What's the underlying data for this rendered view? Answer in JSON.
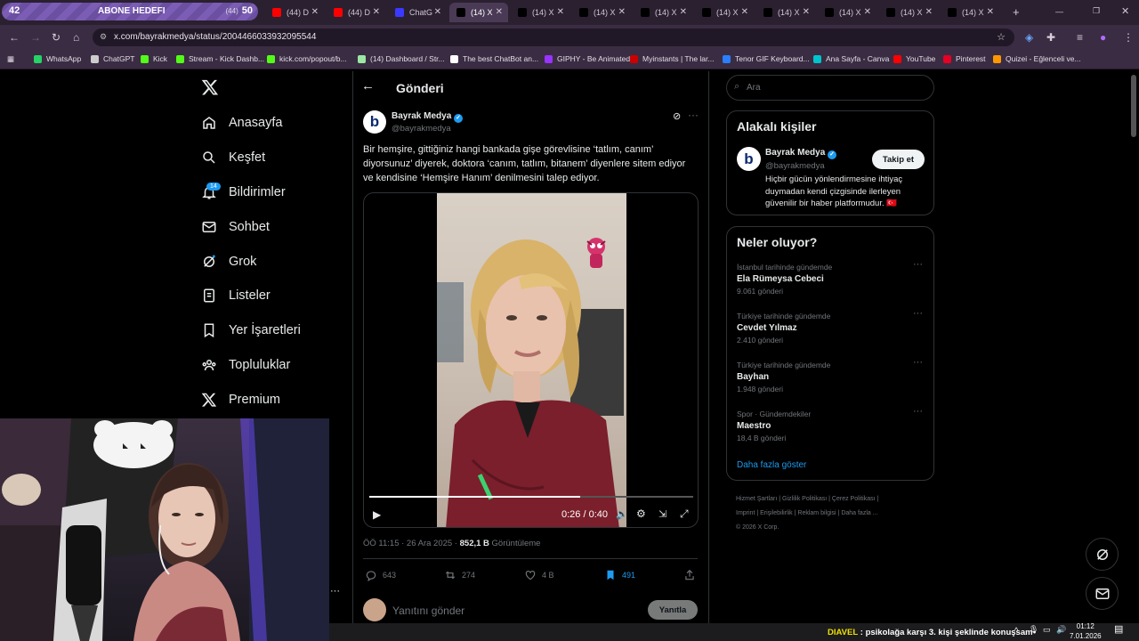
{
  "overlay": {
    "goal_count": "42",
    "goal_label": "ABONE HEDEFI",
    "goal_small": "(44)",
    "goal_target": "50"
  },
  "tabs": [
    {
      "label": "(44) D",
      "color": "#ff0000"
    },
    {
      "label": "(44) D",
      "color": "#ff0000"
    },
    {
      "label": "ChatG",
      "color": "#3a3aff"
    },
    {
      "label": "(14) X",
      "color": "#000000"
    },
    {
      "label": "(14) X",
      "color": "#000000"
    },
    {
      "label": "(14) X",
      "color": "#000000"
    },
    {
      "label": "(14) X",
      "color": "#000000"
    },
    {
      "label": "(14) X",
      "color": "#000000"
    },
    {
      "label": "(14) X",
      "color": "#000000"
    },
    {
      "label": "(14) X",
      "color": "#000000"
    },
    {
      "label": "(14) X",
      "color": "#000000"
    },
    {
      "label": "(14) X",
      "color": "#000000"
    }
  ],
  "browser": {
    "url": "x.com/bayrakmedya/status/2004466033932095544"
  },
  "bookmarks": [
    {
      "label": "WhatsApp",
      "color": "#25d366"
    },
    {
      "label": "ChatGPT",
      "color": "#cccccc"
    },
    {
      "label": "Kick",
      "color": "#53fc18"
    },
    {
      "label": "Stream - Kick Dashb...",
      "color": "#53fc18"
    },
    {
      "label": "kick.com/popout/b...",
      "color": "#53fc18"
    },
    {
      "label": "(14) Dashboard / Str...",
      "color": "#9be7a3"
    },
    {
      "label": "The best ChatBot an...",
      "color": "#ffffff"
    },
    {
      "label": "GIPHY - Be Animated",
      "color": "#9933ff"
    },
    {
      "label": "Myinstants | The lar...",
      "color": "#cc0000"
    },
    {
      "label": "Tenor GIF Keyboard...",
      "color": "#2a7fff"
    },
    {
      "label": "Ana Sayfa - Canva",
      "color": "#00c4cc"
    },
    {
      "label": "YouTube",
      "color": "#ff0000"
    },
    {
      "label": "Pinterest",
      "color": "#e60023"
    },
    {
      "label": "Quizei - Eğlenceli ve...",
      "color": "#ff9800"
    }
  ],
  "nav": {
    "items": [
      {
        "label": "Anasayfa"
      },
      {
        "label": "Keşfet"
      },
      {
        "label": "Bildirimler"
      },
      {
        "label": "Sohbet"
      },
      {
        "label": "Grok"
      },
      {
        "label": "Listeler"
      },
      {
        "label": "Yer İşaretleri"
      },
      {
        "label": "Topluluklar"
      },
      {
        "label": "Premium"
      }
    ],
    "notif_badge": "14"
  },
  "post": {
    "header_title": "Gönderi",
    "author_name": "Bayrak Medya",
    "author_handle": "@bayrakmedya",
    "text": "Bir hemşire, gittiğiniz hangi bankada gişe görevlisine ‘tatlım, canım’ diyorsunuz’ diyerek, doktora ‘canım, tatlım, bitanem’ diyenlere sitem ediyor ve kendisine ‘Hemşire Hanım’ denilmesini talep ediyor.",
    "video_time": "0:26 / 0:40",
    "video_progress": 0.65,
    "meta_time": "ÖÖ 11:15 · 26 Ara 2025 · ",
    "views": "852,1 B",
    "views_label": " Görüntüleme",
    "replies": "643",
    "reposts": "274",
    "likes": "4 B",
    "bookmarks": "491",
    "reply_placeholder": "Yanıtını gönder",
    "reply_button": "Yanıtla"
  },
  "sidebar": {
    "search_placeholder": "Ara",
    "people_title": "Alakalı kişiler",
    "person_name": "Bayrak Medya",
    "person_handle": "@bayrakmedya",
    "follow_label": "Takip et",
    "person_bio": "Hiçbir gücün yönlendirmesine ihtiyaç duymadan kendi çizgisinde ilerleyen güvenilir bir haber platformudur. 🇹🇷",
    "trends_title": "Neler oluyor?",
    "trends": [
      {
        "category": "İstanbul tarihinde gündemde",
        "name": "Ela Rümeysa Cebeci",
        "count": "9.061 gönderi"
      },
      {
        "category": "Türkiye tarihinde gündemde",
        "name": "Cevdet Yılmaz",
        "count": "2.410 gönderi"
      },
      {
        "category": "Türkiye tarihinde gündemde",
        "name": "Bayhan",
        "count": "1.948 gönderi"
      },
      {
        "category": "Spor · Gündemdekiler",
        "name": "Maestro",
        "count": "18,4 B gönderi"
      }
    ],
    "show_more": "Daha fazla göster",
    "footer_links": [
      "Hizmet Şartları",
      "Gizlilik Politikası",
      "Çerez Politikası",
      "Imprint",
      "Erişilebilirlik",
      "Reklam bilgisi",
      "Daha fazla ..."
    ],
    "copyright": "© 2026 X Corp."
  },
  "taskbar": {
    "ticker_name": "DIAVEL",
    "ticker_text": " : psikolağa karşı 3. kişi şeklinde konuşsam",
    "time": "01:12",
    "date": "7.01.2026"
  }
}
